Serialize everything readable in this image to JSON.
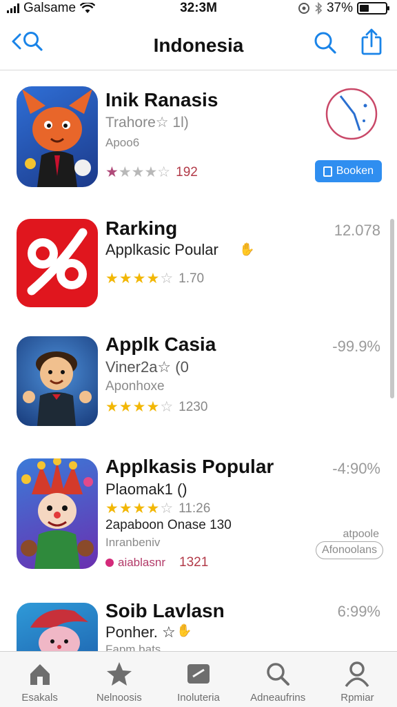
{
  "status_bar": {
    "carrier": "Galsame",
    "time": "32:3M",
    "battery": "37%",
    "battery_level": 0.37
  },
  "nav": {
    "title": "Indonesia"
  },
  "apps": [
    {
      "title": "Inik Ranasis",
      "line1": "Trahore☆ 1l)",
      "line2": "Apoo6",
      "rating_count": "192",
      "action_label": "Booken",
      "icon": "fox-character-icon"
    },
    {
      "title": "Rarking",
      "line1": "Applkasic Poular",
      "rating_count": "1.70",
      "percent": "12.078",
      "icon": "percent-logo-icon"
    },
    {
      "title": "Applk Casia",
      "line1": "Viner2a☆ (0",
      "line2": "Aponhoxe",
      "rating_count": "1230",
      "percent": "-99.9%",
      "icon": "boy-character-icon"
    },
    {
      "title": "Applkasis Popular",
      "line1": "Plaomak1 ()",
      "rating_count": "11:26",
      "line3": "2apaboon Onase 130",
      "line4": "Inranbeniv",
      "line5": "aiablasnr",
      "line5_count": "1321",
      "percent": "-4:90%",
      "small_text": "atpoole",
      "outline_label": "Afonoolans",
      "icon": "jester-character-icon"
    },
    {
      "title": "Soib Lavlasn",
      "line1": "Ponher. ☆",
      "line2": "Fapm bats",
      "percent": "6:99%",
      "icon": "pink-character-icon"
    }
  ],
  "tabs": [
    {
      "label": "Esakals",
      "icon": "home-icon"
    },
    {
      "label": "Nelnoosis",
      "icon": "star-icon"
    },
    {
      "label": "Inoluteria",
      "icon": "category-icon"
    },
    {
      "label": "Adneaufrins",
      "icon": "search-icon"
    },
    {
      "label": "Rpmiar",
      "icon": "person-icon"
    }
  ]
}
